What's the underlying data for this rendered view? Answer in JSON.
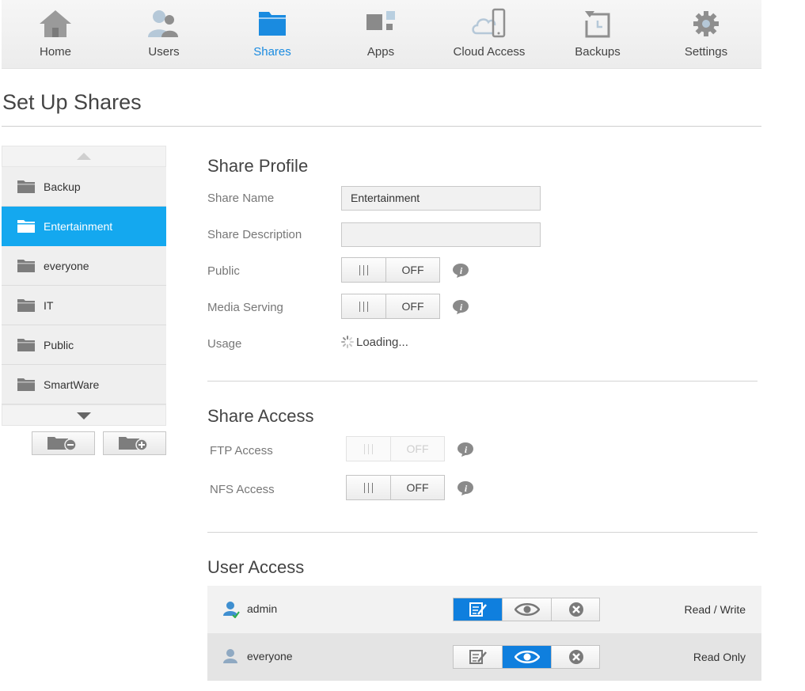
{
  "nav": {
    "items": [
      {
        "label": "Home",
        "icon": "home-icon"
      },
      {
        "label": "Users",
        "icon": "users-icon"
      },
      {
        "label": "Shares",
        "icon": "shares-folder-icon",
        "active": true
      },
      {
        "label": "Apps",
        "icon": "apps-icon"
      },
      {
        "label": "Cloud Access",
        "icon": "cloud-access-icon"
      },
      {
        "label": "Backups",
        "icon": "backups-icon"
      },
      {
        "label": "Settings",
        "icon": "gear-icon"
      }
    ]
  },
  "page": {
    "title": "Set Up Shares"
  },
  "shares": {
    "items": [
      "Backup",
      "Entertainment",
      "everyone",
      "IT",
      "Public",
      "SmartWare"
    ],
    "selected": "Entertainment"
  },
  "profile": {
    "heading": "Share Profile",
    "share_name_label": "Share Name",
    "share_name_value": "Entertainment",
    "share_description_label": "Share Description",
    "share_description_value": "",
    "public_label": "Public",
    "public_state": "OFF",
    "media_serving_label": "Media Serving",
    "media_serving_state": "OFF",
    "usage_label": "Usage",
    "usage_value": "Loading..."
  },
  "access": {
    "heading": "Share Access",
    "ftp_label": "FTP Access",
    "ftp_state": "OFF",
    "nfs_label": "NFS Access",
    "nfs_state": "OFF"
  },
  "user_access": {
    "heading": "User Access",
    "users": [
      {
        "name": "admin",
        "access": "Read / Write",
        "selected": "read-write"
      },
      {
        "name": "everyone",
        "access": "Read Only",
        "selected": "read-only"
      }
    ]
  },
  "colors": {
    "accent": "#14a8ef",
    "active_nav": "#1a8be0",
    "permission_selected": "#0f7fde"
  }
}
